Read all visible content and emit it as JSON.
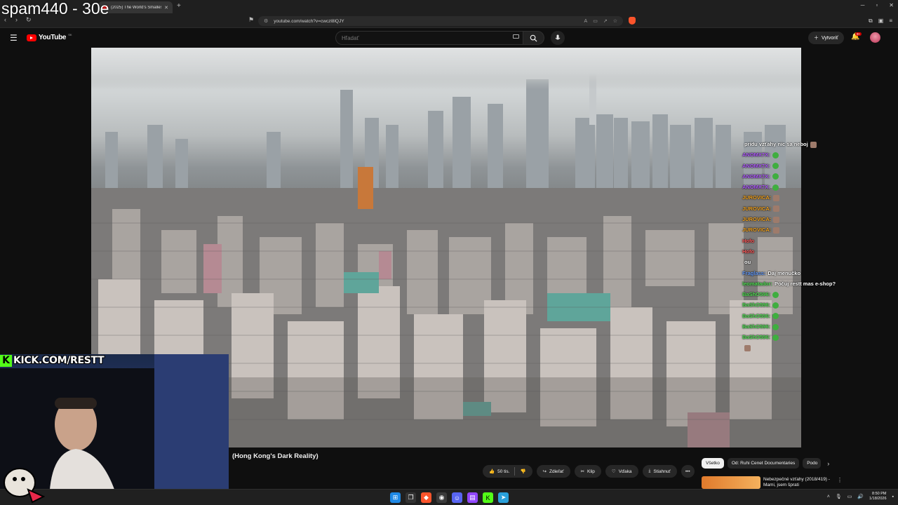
{
  "overlay": {
    "spam_text": "spam440 - 30e"
  },
  "browser": {
    "tab_title": "(2025) The World's Smallest Ap",
    "url": "youtube.com/watch?v=cwczl8lQJY"
  },
  "youtube": {
    "logo_text": "YouTube",
    "country_code": "SK",
    "search_placeholder": "Hľadať",
    "create_label": "Vytvoriť",
    "notification_count": "9+"
  },
  "video": {
    "title": "(Hong Kong's Dark Reality)"
  },
  "chat": {
    "messages": [
      {
        "user": "",
        "text": "pridu vzťahy nic sa neboj",
        "color": "#ffffff",
        "emote": "brown"
      },
      {
        "user": "ANOMX7X:",
        "text": "",
        "color": "#b25cff",
        "emote": "green"
      },
      {
        "user": "ANOMX7X:",
        "text": "",
        "color": "#b25cff",
        "emote": "green"
      },
      {
        "user": "ANOMX7X:",
        "text": "",
        "color": "#b25cff",
        "emote": "green"
      },
      {
        "user": "ANOMX7X:",
        "text": "",
        "color": "#b25cff",
        "emote": "green"
      },
      {
        "user": "JUROVICA:",
        "text": "",
        "color": "#f5a623",
        "emote": "brown"
      },
      {
        "user": "JUROVICA:",
        "text": "",
        "color": "#f5a623",
        "emote": "brown"
      },
      {
        "user": "JUROVICA:",
        "text": "",
        "color": "#f5a623",
        "emote": "brown"
      },
      {
        "user": "JUROVICA:",
        "text": "",
        "color": "#f5a623",
        "emote": "brown"
      },
      {
        "user": "Hofo",
        "text": "",
        "color": "#ff5a5a",
        "emote": ""
      },
      {
        "user": "Hofo",
        "text": "",
        "color": "#ff5a5a",
        "emote": ""
      },
      {
        "user": "",
        "text": "ou",
        "color": "#ffffff",
        "emote": ""
      },
      {
        "user": "Fraglass:",
        "text": "Daj menučko",
        "color": "#6aa0ff",
        "emote": ""
      },
      {
        "user": "leomatador:",
        "text": "Počuj restt mas e-shop?",
        "color": "#57e65a",
        "emote": ""
      },
      {
        "user": "BaShO596:",
        "text": "",
        "color": "#57e65a",
        "emote": "green"
      },
      {
        "user": "BaShO596:",
        "text": "",
        "color": "#57e65a",
        "emote": "green"
      },
      {
        "user": "BaShO596:",
        "text": "",
        "color": "#57e65a",
        "emote": "green"
      },
      {
        "user": "BaShO596:",
        "text": "",
        "color": "#57e65a",
        "emote": "green"
      },
      {
        "user": "BaShO596:",
        "text": "",
        "color": "#57e65a",
        "emote": "green"
      },
      {
        "user": "",
        "text": "",
        "color": "#ff3b3b",
        "emote": "brown"
      }
    ]
  },
  "stream": {
    "kick_url": "KICK.COM/RESTT",
    "kick_logo": "K"
  },
  "actions": {
    "likes": "50 tis.",
    "share": "Zdieľať",
    "clip": "Klip",
    "thanks": "Vďaka",
    "download": "Stiahnuť"
  },
  "chips": [
    "Všetko",
    "Od: Ruhi Cenet Documentaries",
    "Podo"
  ],
  "recommendation": {
    "title": "Nebezpečné vzťahy (2018/419) - Mami, jsem šprati"
  },
  "taskbar": {
    "time": "8:50 PM",
    "date": "1/18/2026"
  }
}
